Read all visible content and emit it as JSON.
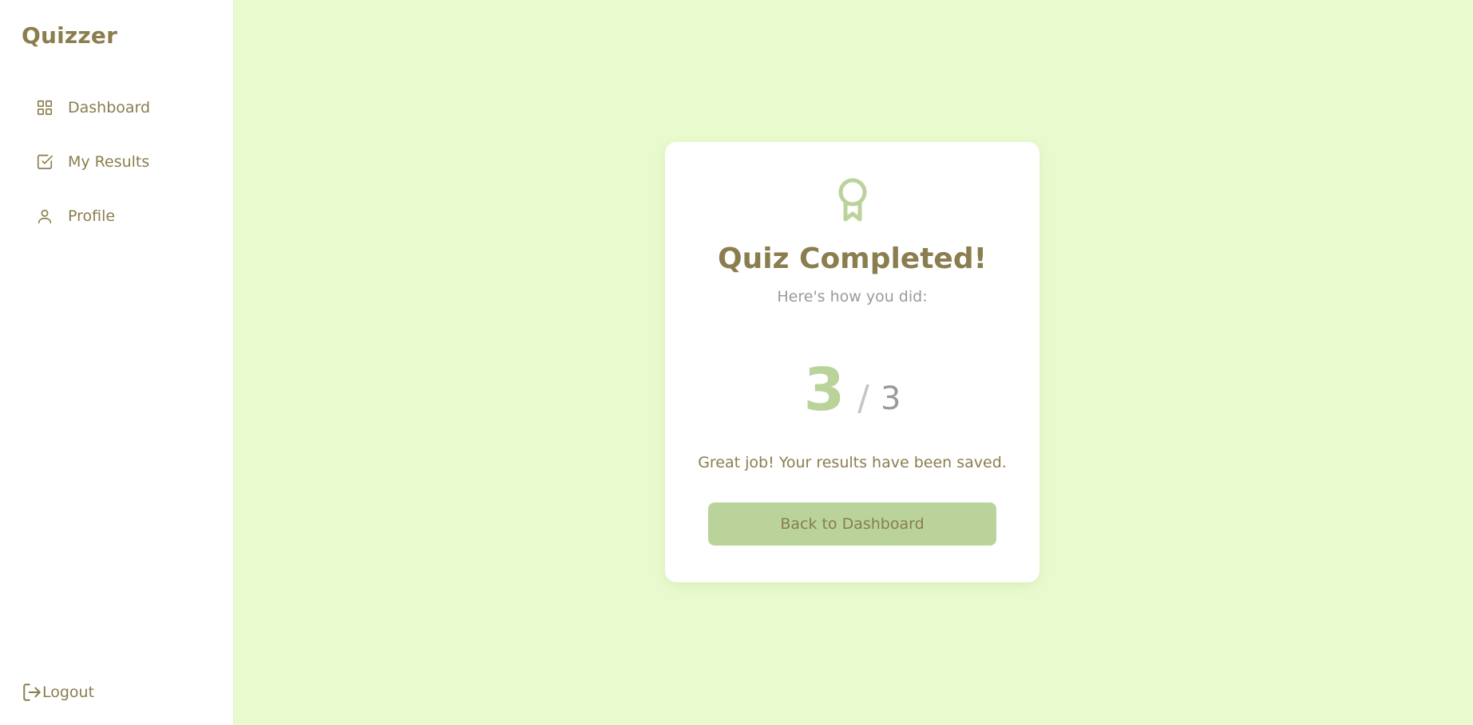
{
  "app": {
    "brand": "Quizzer"
  },
  "sidebar": {
    "items": [
      {
        "label": "Dashboard",
        "icon": "grid-icon"
      },
      {
        "label": "My Results",
        "icon": "checkbox-icon"
      },
      {
        "label": "Profile",
        "icon": "user-icon"
      }
    ],
    "logout_label": "Logout"
  },
  "result": {
    "icon": "award-icon",
    "title": "Quiz Completed!",
    "subtitle": "Here's how you did:",
    "score": "3",
    "separator": "/",
    "total": "3",
    "message": "Great job! Your results have been saved.",
    "button_label": "Back to Dashboard"
  },
  "colors": {
    "background": "#e9fbce",
    "accent": "#bad39b",
    "text_primary": "#8a7d4e",
    "text_muted": "#9a9a9a"
  }
}
